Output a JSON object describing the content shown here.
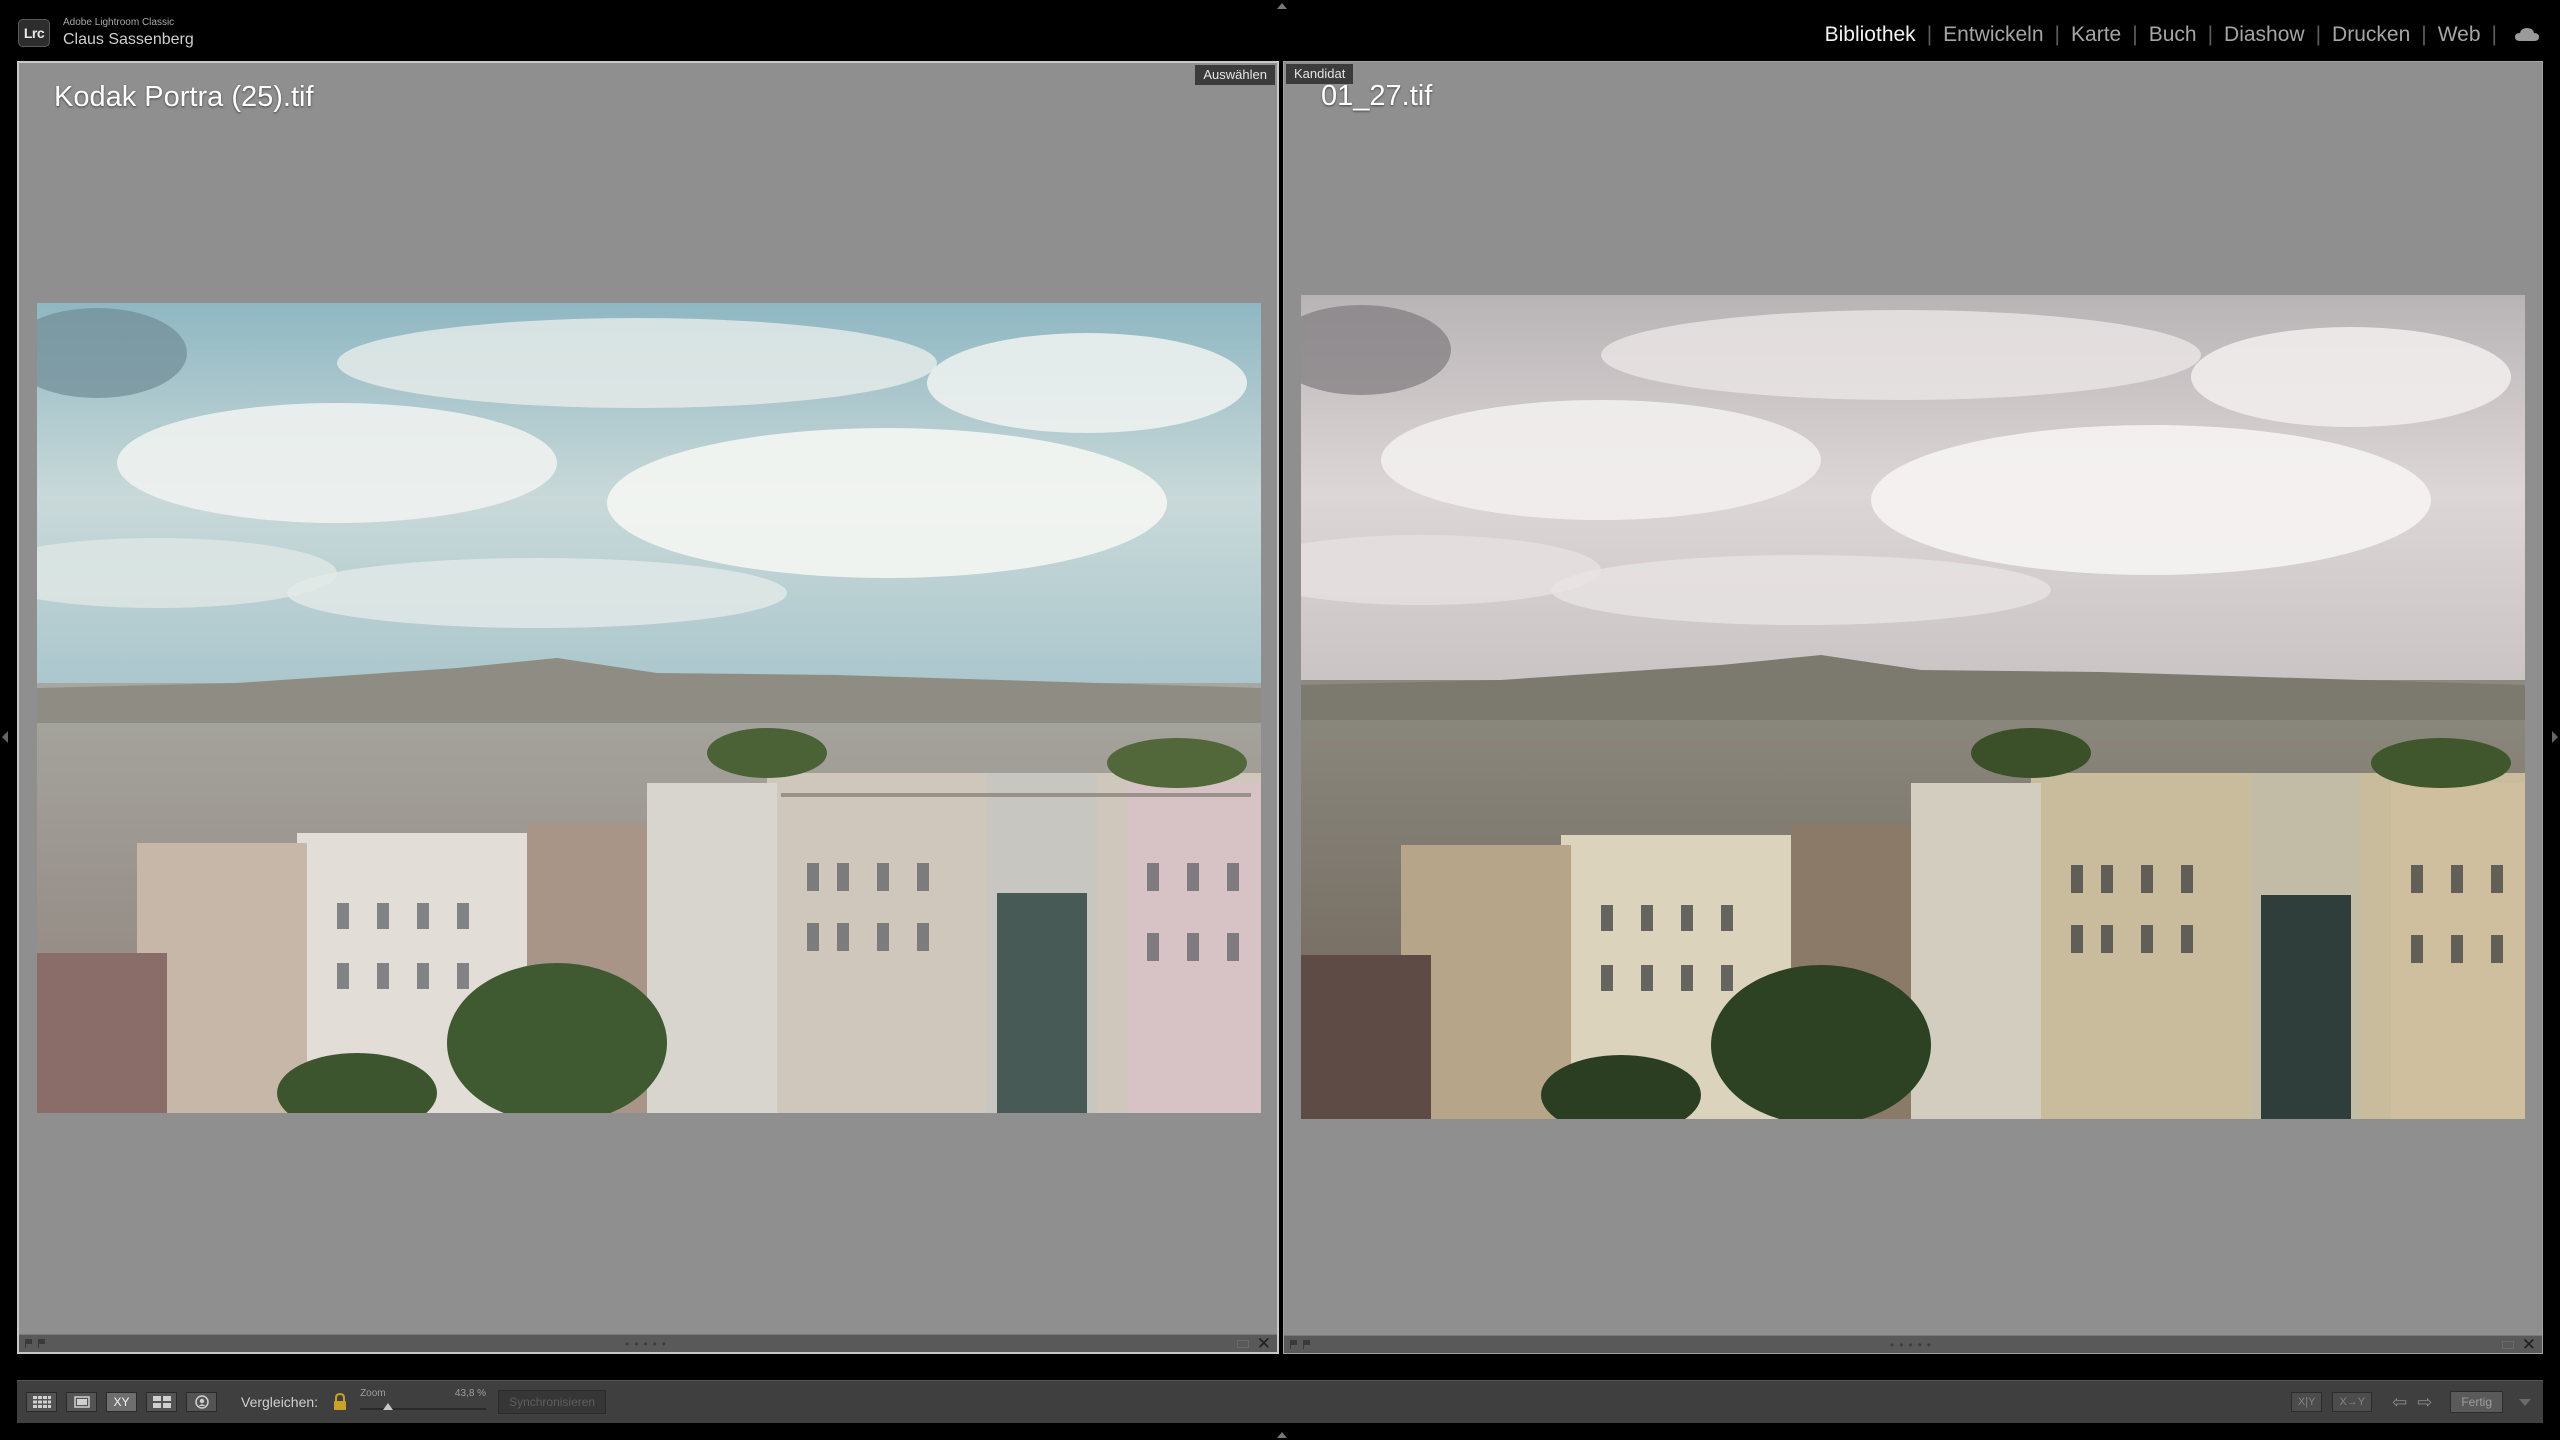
{
  "app": {
    "name": "Adobe Lightroom Classic",
    "badge": "Lrc",
    "user": "Claus Sassenberg"
  },
  "modules": [
    {
      "label": "Bibliothek",
      "active": true
    },
    {
      "label": "Entwickeln",
      "active": false
    },
    {
      "label": "Karte",
      "active": false
    },
    {
      "label": "Buch",
      "active": false
    },
    {
      "label": "Diashow",
      "active": false
    },
    {
      "label": "Drucken",
      "active": false
    },
    {
      "label": "Web",
      "active": false
    }
  ],
  "compare": {
    "select": {
      "tag": "Auswählen",
      "filename": "Kodak Portra (25).tif"
    },
    "candidate": {
      "tag": "Kandidat",
      "filename": "01_27.tif"
    }
  },
  "toolbar": {
    "compare_label": "Vergleichen:",
    "zoom_label": "Zoom",
    "zoom_value": "43,8 %",
    "zoom_level_percent": 43.8,
    "sync_label": "Synchronisieren",
    "swap_label": "X|Y",
    "make_select_label": "X→Y",
    "done_label": "Fertig",
    "survey_icon_text": "XY"
  },
  "colors": {
    "pane_bg": "#8f8f8f",
    "active_module": "#f2f2f2",
    "inactive_module": "#a5a5a5",
    "toolbar_bg": "#3f3f3f"
  },
  "icons": [
    "grid-view-icon",
    "loupe-view-icon",
    "compare-view-icon",
    "survey-view-icon",
    "people-view-icon",
    "lock-icon",
    "cloud-icon",
    "flag-icon",
    "close-icon",
    "arrow-left-icon",
    "arrow-right-icon",
    "chevron-down-icon"
  ]
}
